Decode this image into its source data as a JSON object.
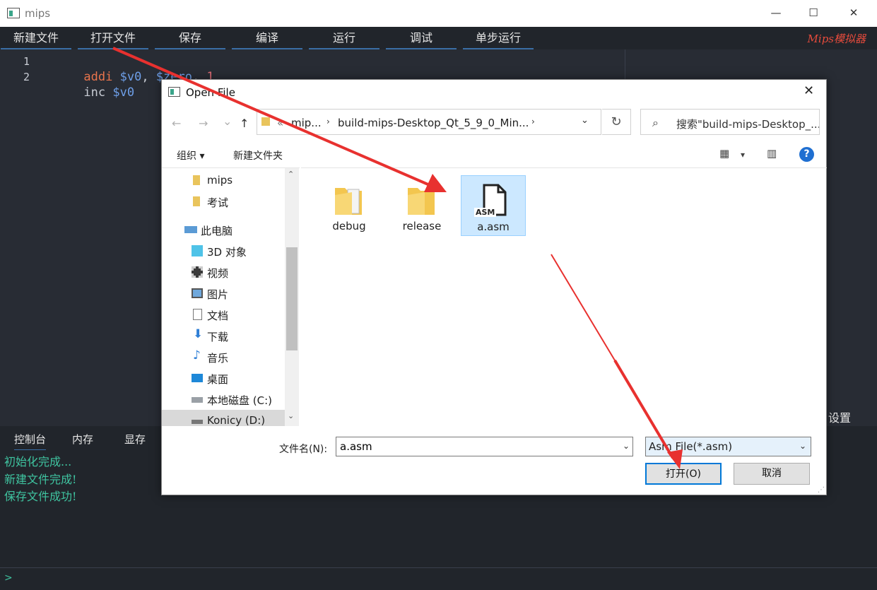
{
  "window": {
    "title": "mips",
    "minimize": "—",
    "maximize": "☐",
    "close": "✕"
  },
  "menu": {
    "items": [
      "新建文件",
      "打开文件",
      "保存",
      "编译",
      "运行",
      "调试",
      "单步运行"
    ],
    "brand": "Mips模拟器"
  },
  "editor": {
    "lines": [
      {
        "no": "1",
        "tokens": [
          [
            "kw",
            "addi "
          ],
          [
            "reg",
            "$v0"
          ],
          [
            "plain",
            ", "
          ],
          [
            "reg",
            "$zero"
          ],
          [
            "plain",
            ", "
          ],
          [
            "num",
            "1"
          ]
        ]
      },
      {
        "no": "2",
        "tokens": [
          [
            "plain",
            "inc "
          ],
          [
            "reg",
            "$v0"
          ]
        ]
      }
    ]
  },
  "side": {
    "settings_tab": "设置"
  },
  "bottom": {
    "tabs": [
      "控制台",
      "内存",
      "显存"
    ],
    "console": [
      "初始化完成...",
      "新建文件完成!",
      "保存文件成功!"
    ],
    "prompt": ">"
  },
  "dialog": {
    "title": "Open File",
    "close": "✕",
    "nav": {
      "back": "←",
      "forward": "→",
      "recent": "⌄",
      "up": "↑"
    },
    "address": {
      "prefix": "«",
      "segments": [
        "mip...",
        "build-mips-Desktop_Qt_5_9_0_Min..."
      ],
      "chevron": "›",
      "dropdown": "⌄"
    },
    "refresh": "↻",
    "search": {
      "icon": "⌕",
      "placeholder": "搜索\"build-mips-Desktop_..."
    },
    "toolbar": {
      "organize": "组织 ▾",
      "new_folder": "新建文件夹",
      "view_icon": "▦",
      "view_drop": "▾",
      "preview_icon": "▥",
      "help": "?"
    },
    "nav_tree": [
      {
        "label": "mips",
        "icon": "folder",
        "indent": 2
      },
      {
        "label": "考试",
        "icon": "folder",
        "indent": 2
      },
      {
        "label": "此电脑",
        "icon": "pc",
        "indent": 1
      },
      {
        "label": "3D 对象",
        "icon": "3d",
        "indent": 2
      },
      {
        "label": "视频",
        "icon": "video",
        "indent": 2
      },
      {
        "label": "图片",
        "icon": "picture",
        "indent": 2
      },
      {
        "label": "文档",
        "icon": "doc",
        "indent": 2
      },
      {
        "label": "下载",
        "icon": "download",
        "indent": 2
      },
      {
        "label": "音乐",
        "icon": "music",
        "indent": 2
      },
      {
        "label": "桌面",
        "icon": "desktop",
        "indent": 2
      },
      {
        "label": "本地磁盘 (C:)",
        "icon": "disk",
        "indent": 2
      },
      {
        "label": "Konicy (D:)",
        "icon": "disk",
        "indent": 2,
        "selected": true
      }
    ],
    "scroll": {
      "up": "⌃",
      "down": "⌄"
    },
    "files": [
      {
        "name": "debug",
        "kind": "folder"
      },
      {
        "name": "release",
        "kind": "folder"
      },
      {
        "name": "a.asm",
        "kind": "asm",
        "badge": "ASM",
        "selected": true
      }
    ],
    "filename_label": "文件名(N):",
    "filename_value": "a.asm",
    "filetype": "Asm File(*.asm)",
    "open_button": "打开(O)",
    "cancel_button": "取消",
    "grip": "⋰"
  },
  "colors": {
    "accent": "#3a6ea5",
    "console": "#3fc4a0",
    "arrow": "#e8312f",
    "brand": "#e64b3c"
  }
}
